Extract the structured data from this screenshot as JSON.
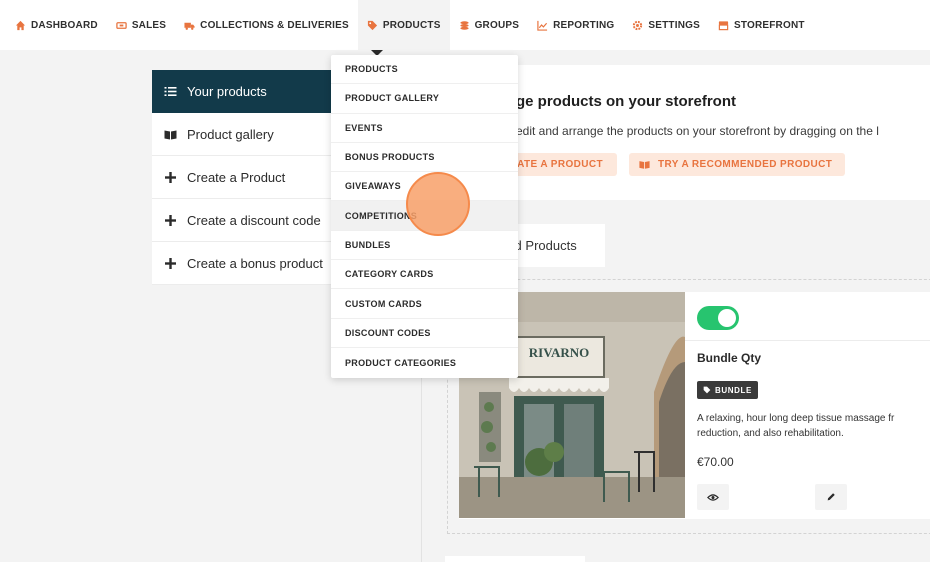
{
  "nav": {
    "items": [
      {
        "label": "DASHBOARD",
        "icon": "home-icon"
      },
      {
        "label": "SALES",
        "icon": "ticket-icon"
      },
      {
        "label": "COLLECTIONS & DELIVERIES",
        "icon": "truck-icon"
      },
      {
        "label": "PRODUCTS",
        "icon": "tag-icon"
      },
      {
        "label": "GROUPS",
        "icon": "layers-icon"
      },
      {
        "label": "REPORTING",
        "icon": "chart-icon"
      },
      {
        "label": "SETTINGS",
        "icon": "gear-icon"
      },
      {
        "label": "STOREFRONT",
        "icon": "store-icon"
      }
    ],
    "active": "PRODUCTS",
    "accent_color": "#e8743f"
  },
  "sidebar": {
    "items": [
      {
        "label": "Your products",
        "icon": "list-icon"
      },
      {
        "label": "Product gallery",
        "icon": "book-icon"
      },
      {
        "label": "Create a Product",
        "icon": "plus-icon"
      },
      {
        "label": "Create a discount code",
        "icon": "plus-icon"
      },
      {
        "label": "Create a bonus product",
        "icon": "plus-icon"
      }
    ],
    "active_color": "#123a4a"
  },
  "dropdown": {
    "items": [
      "PRODUCTS",
      "PRODUCT GALLERY",
      "EVENTS",
      "BONUS PRODUCTS",
      "GIVEAWAYS",
      "COMPETITIONS",
      "BUNDLES",
      "CATEGORY CARDS",
      "CUSTOM CARDS",
      "DISCOUNT CODES",
      "PRODUCT CATEGORIES"
    ],
    "hovered": "COMPETITIONS"
  },
  "main": {
    "title": "ge products on your storefront",
    "description": "edit and arrange the products on your storefront by dragging on the l",
    "create_button": "EATE A PRODUCT",
    "recommend_button": "TRY A RECOMMENDED PRODUCT",
    "featured_tab": "red Products"
  },
  "product": {
    "name": "Bundle Qty",
    "badge": "BUNDLE",
    "description": "A relaxing, hour long deep tissue massage fr\nreduction, and also rehabilitation.",
    "price": "€70.00",
    "image_sign_text": "RIVARNO",
    "enabled": true,
    "toggle_color": "#27c46f"
  }
}
